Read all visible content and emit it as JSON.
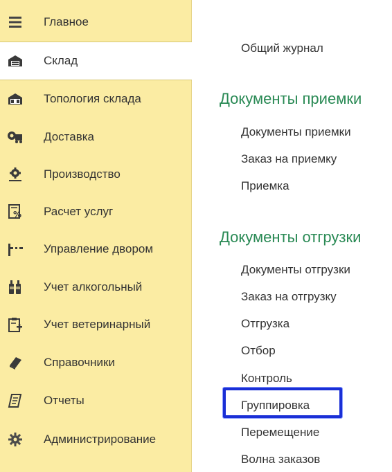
{
  "sidebar": {
    "items": [
      {
        "label": "Главное",
        "icon": "menu-lines-icon"
      },
      {
        "label": "Склад",
        "icon": "warehouse-icon"
      },
      {
        "label": "Топология склада",
        "icon": "warehouse-topology-icon"
      },
      {
        "label": "Доставка",
        "icon": "delivery-truck-icon"
      },
      {
        "label": "Производство",
        "icon": "production-gear-icon"
      },
      {
        "label": "Расчет услуг",
        "icon": "percent-document-icon"
      },
      {
        "label": "Управление двором",
        "icon": "barrier-gate-icon"
      },
      {
        "label": "Учет алкогольный",
        "icon": "bottles-icon"
      },
      {
        "label": "Учет ветеринарный",
        "icon": "clipboard-plus-icon"
      },
      {
        "label": "Справочники",
        "icon": "book-icon"
      },
      {
        "label": "Отчеты",
        "icon": "report-scroll-icon"
      },
      {
        "label": "Администрирование",
        "icon": "settings-gear-icon"
      }
    ]
  },
  "main": {
    "journal": "Общий журнал",
    "receiving": {
      "title": "Документы приемки",
      "links": [
        "Документы приемки",
        "Заказ на приемку",
        "Приемка"
      ]
    },
    "shipping": {
      "title": "Документы отгрузки",
      "links": [
        "Документы отгрузки",
        "Заказ на отгрузку",
        "Отгрузка",
        "Отбор",
        "Контроль",
        "Группировка",
        "Перемещение",
        "Волна заказов"
      ]
    }
  },
  "colors": {
    "sidebar_bg": "#fbeca3",
    "section_title": "#2a8a55",
    "highlight": "#1a2fd6"
  }
}
